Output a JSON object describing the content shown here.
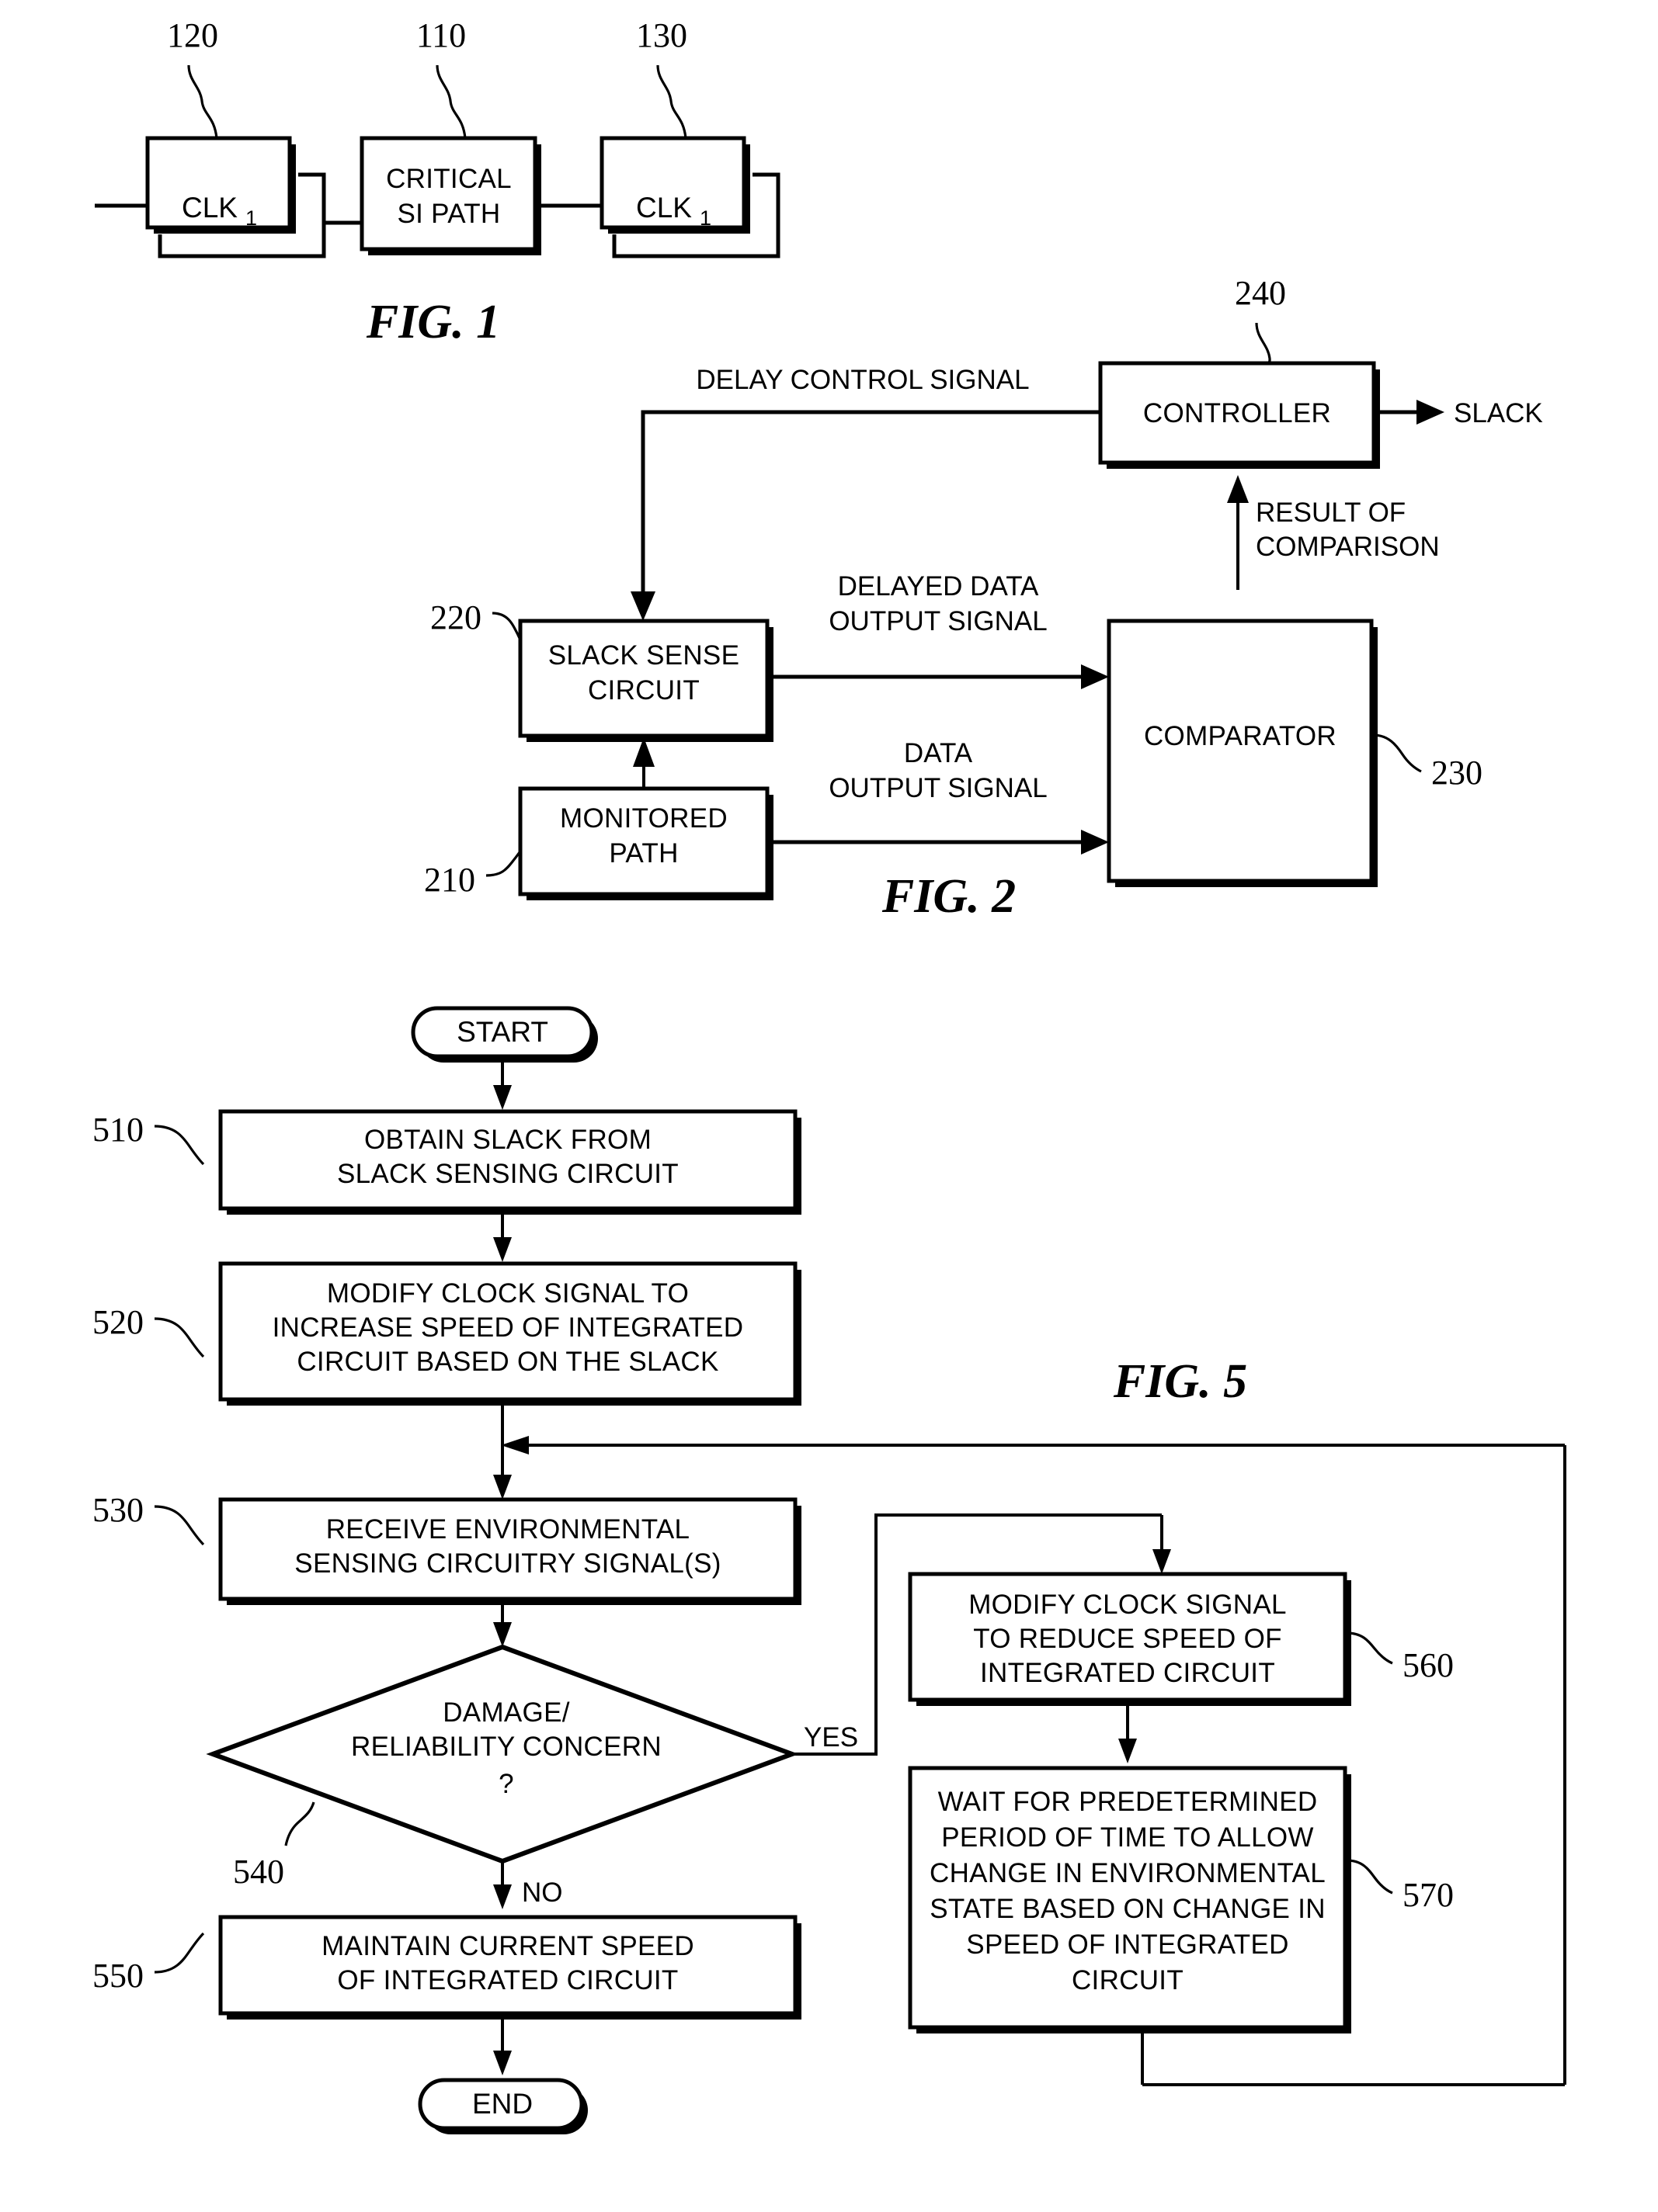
{
  "sheet": {
    "figures": [
      "FIG. 1",
      "FIG. 2",
      "FIG. 5"
    ]
  },
  "fig1": {
    "caption": "FIG. 1",
    "refs": {
      "clk1": "120",
      "critical": "110",
      "clk2": "130"
    },
    "blocks": {
      "clk_left": {
        "label": "CLK",
        "subscript": "1"
      },
      "critical_path": {
        "line1": "CRITICAL",
        "line2": "SI PATH"
      },
      "clk_right": {
        "label": "CLK",
        "subscript": "1"
      }
    }
  },
  "fig2": {
    "caption": "FIG. 2",
    "refs": {
      "controller": "240",
      "slack_sense": "220",
      "comparator": "230",
      "monitored_path": "210"
    },
    "blocks": {
      "controller": "CONTROLLER",
      "slack_sense": {
        "line1": "SLACK SENSE",
        "line2": "CIRCUIT"
      },
      "monitored_path": {
        "line1": "MONITORED",
        "line2": "PATH"
      },
      "comparator": "COMPARATOR"
    },
    "signals": {
      "delay_control": "DELAY CONTROL SIGNAL",
      "slack_out": "SLACK",
      "result_of_comparison": {
        "line1": "RESULT OF",
        "line2": "COMPARISON"
      },
      "delayed_data": {
        "line1": "DELAYED DATA",
        "line2": "OUTPUT SIGNAL"
      },
      "data_output": {
        "line1": "DATA",
        "line2": "OUTPUT SIGNAL"
      }
    }
  },
  "fig5": {
    "caption": "FIG. 5",
    "terminals": {
      "start": "START",
      "end": "END"
    },
    "refs": {
      "s510": "510",
      "s520": "520",
      "s530": "530",
      "s540": "540",
      "s550": "550",
      "s560": "560",
      "s570": "570"
    },
    "steps": {
      "s510": [
        "OBTAIN SLACK FROM",
        "SLACK SENSING CIRCUIT"
      ],
      "s520": [
        "MODIFY CLOCK SIGNAL TO",
        "INCREASE SPEED OF INTEGRATED",
        "CIRCUIT BASED ON THE SLACK"
      ],
      "s530": [
        "RECEIVE ENVIRONMENTAL",
        "SENSING CIRCUITRY SIGNAL(S)"
      ],
      "s540": [
        "DAMAGE/",
        "RELIABILITY CONCERN",
        "?"
      ],
      "s550": [
        "MAINTAIN CURRENT SPEED",
        "OF INTEGRATED CIRCUIT"
      ],
      "s560": [
        "MODIFY CLOCK SIGNAL",
        "TO REDUCE SPEED OF",
        "INTEGRATED CIRCUIT"
      ],
      "s570": [
        "WAIT FOR PREDETERMINED",
        "PERIOD OF TIME TO ALLOW",
        "CHANGE IN ENVIRONMENTAL",
        "STATE BASED ON CHANGE IN",
        "SPEED OF INTEGRATED",
        "CIRCUIT"
      ]
    },
    "branches": {
      "yes": "YES",
      "no": "NO"
    }
  },
  "colors": {
    "ink": "#000000",
    "paper": "#ffffff"
  }
}
